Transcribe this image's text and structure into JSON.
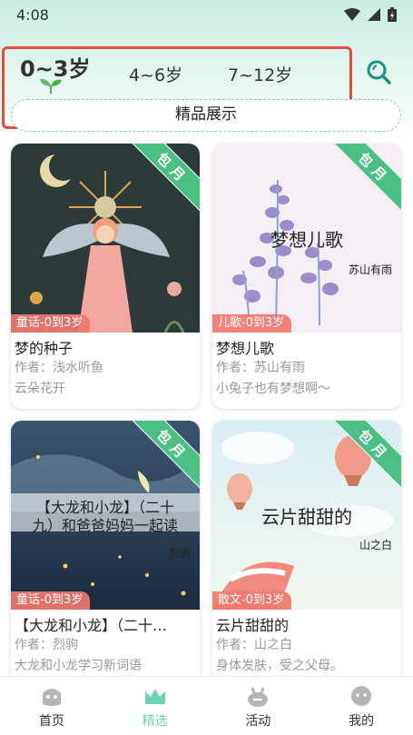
{
  "status_bar": {
    "time": "4:08"
  },
  "age_tabs": [
    {
      "label": "0~3岁",
      "active": true
    },
    {
      "label": "4~6岁",
      "active": false
    },
    {
      "label": "7~12岁",
      "active": false
    }
  ],
  "premium_label": "精品展示",
  "cards": [
    {
      "ribbon": "包月",
      "genre": "童话-0到3岁",
      "name": "梦的种子",
      "author": "作者：浅水听鱼",
      "desc": "云朵花开",
      "cover_title": "",
      "cover_author": ""
    },
    {
      "ribbon": "包月",
      "genre": "儿歌-0到3岁",
      "name": "梦想儿歌",
      "author": "作者：苏山有雨",
      "desc": "小兔子也有梦想啊～",
      "cover_title": "梦想儿歌",
      "cover_author": "苏山有雨"
    },
    {
      "ribbon": "包月",
      "genre": "童话-0到3岁",
      "name": "【大龙和小龙】（二十…",
      "author": "作者：烈驹",
      "desc": "大龙和小龙学习新词语",
      "cover_title_line1": "【大龙和小龙】（二十",
      "cover_title_line2": "九）和爸爸妈妈一起读",
      "cover_author": "烈驹"
    },
    {
      "ribbon": "包月",
      "genre": "散文-0到3岁",
      "name": "云片甜甜的",
      "author": "作者：山之白",
      "desc": "身体发肤，受之父母。",
      "cover_title": "云片甜甜的",
      "cover_author": "山之白"
    }
  ],
  "nav": [
    {
      "label": "首页",
      "icon": "home-icon",
      "active": false
    },
    {
      "label": "精选",
      "icon": "crown-icon",
      "active": true
    },
    {
      "label": "活动",
      "icon": "activity-icon",
      "active": false
    },
    {
      "label": "我的",
      "icon": "profile-icon",
      "active": false
    }
  ],
  "colors": {
    "accent": "#6dd3b5",
    "ribbon": "#4bbf84",
    "highlight_border": "#e64b3c",
    "genre_tag": "#f0786e"
  }
}
